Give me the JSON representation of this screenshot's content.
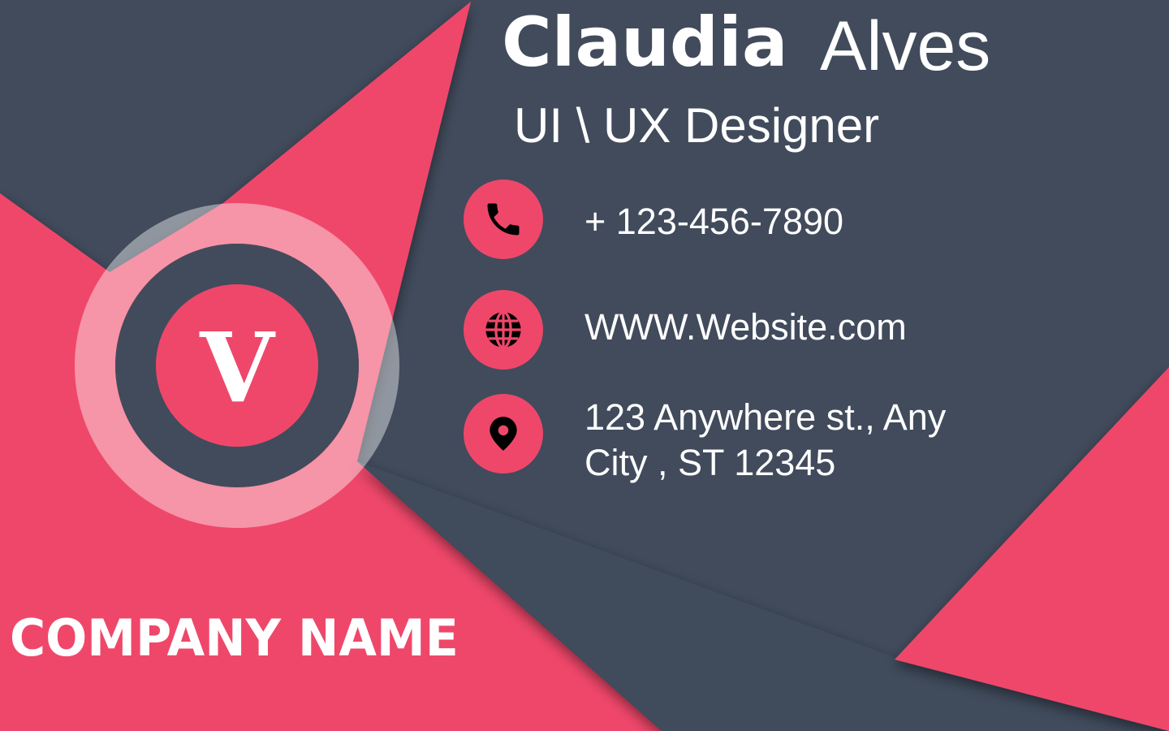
{
  "card": {
    "first_name": "Claudia",
    "last_name": "Alves",
    "job_title": "UI \\ UX Designer",
    "logo_letter": "V",
    "company_name": "COMPANY NAME"
  },
  "contacts": {
    "phone": {
      "icon": "phone-icon",
      "text": "+ 123-456-7890"
    },
    "website": {
      "icon": "globe-icon",
      "text": "WWW.Website.com"
    },
    "address": {
      "icon": "location-pin-icon",
      "text": "123 Anywhere st., Any City , ST 12345"
    }
  },
  "colors": {
    "slate": "#414b5c",
    "coral": "#ef476a",
    "white": "#ffffff",
    "black": "#000000"
  }
}
